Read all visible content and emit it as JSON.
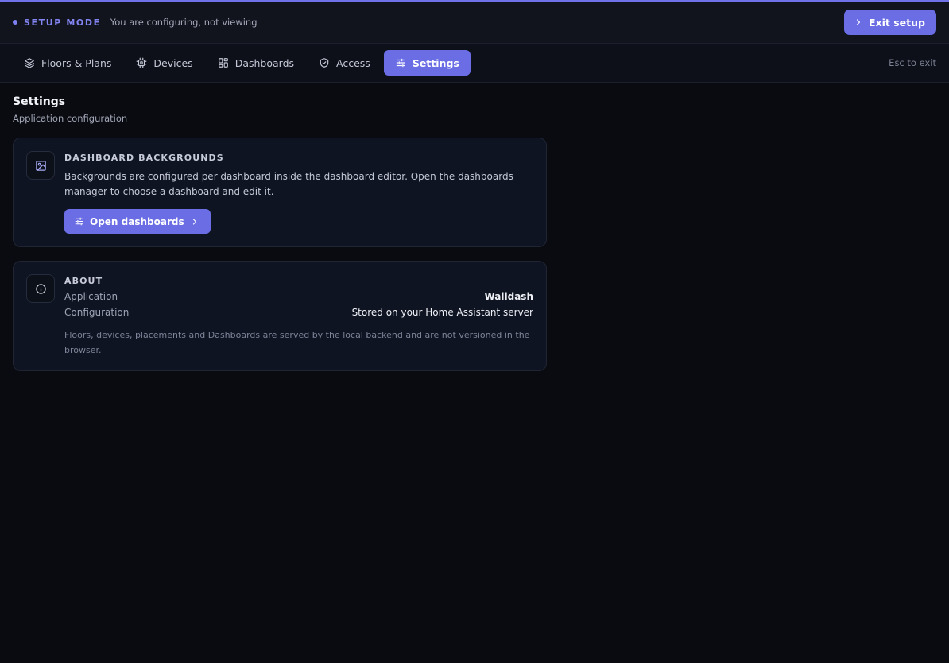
{
  "topbar": {
    "mode_label": "SETUP MODE",
    "mode_subtitle": "You are configuring, not viewing",
    "exit_label": "Exit setup"
  },
  "tabs": [
    {
      "label": "Floors & Plans",
      "icon": "layers-icon",
      "active": false
    },
    {
      "label": "Devices",
      "icon": "chip-icon",
      "active": false
    },
    {
      "label": "Dashboards",
      "icon": "grid-icon",
      "active": false
    },
    {
      "label": "Access",
      "icon": "shield-icon",
      "active": false
    },
    {
      "label": "Settings",
      "icon": "sliders-icon",
      "active": true
    }
  ],
  "esc_hint": "Esc to exit",
  "page": {
    "title": "Settings",
    "subtitle": "Application configuration"
  },
  "backgrounds_card": {
    "icon": "image-icon",
    "title": "DASHBOARD BACKGROUNDS",
    "description": "Backgrounds are configured per dashboard inside the dashboard editor. Open the dashboards manager to choose a dashboard and edit it.",
    "button_label": "Open dashboards"
  },
  "about_card": {
    "icon": "info-icon",
    "title": "ABOUT",
    "rows": [
      {
        "key": "Application",
        "value": "Walldash"
      },
      {
        "key": "Configuration",
        "value": "Stored on your Home Assistant server"
      }
    ],
    "note": "Floors, devices, placements and Dashboards are served by the local backend and are not versioned in the browser."
  },
  "colors": {
    "accent": "#6a6de4",
    "background": "#0a0b10",
    "card": "#0e1421"
  }
}
